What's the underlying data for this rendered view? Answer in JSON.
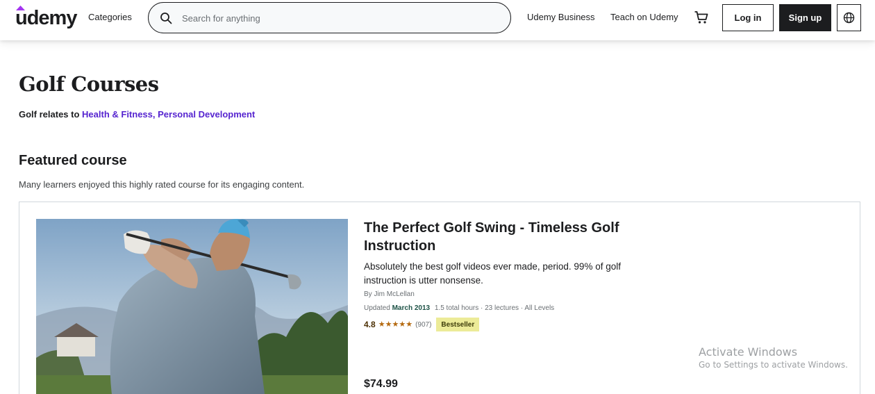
{
  "header": {
    "logo": "udemy",
    "categories_label": "Categories",
    "search_placeholder": "Search for anything",
    "business_label": "Udemy Business",
    "teach_label": "Teach on Udemy",
    "login_label": "Log in",
    "signup_label": "Sign up",
    "icons": {
      "search": "search-icon",
      "cart": "cart-icon",
      "language": "globe-icon"
    },
    "brand_color": "#a435f0"
  },
  "page": {
    "title": "Golf Courses",
    "relates_prefix": "Golf relates to ",
    "relates_links": "Health & Fitness, Personal Development",
    "link_color": "#5624d0"
  },
  "featured": {
    "heading": "Featured course",
    "subtitle": "Many learners enjoyed this highly rated course for its engaging content.",
    "course": {
      "title": "The Perfect Golf Swing - Timeless Golf Instruction",
      "description": "Absolutely the best golf videos ever made, period. 99% of golf instruction is utter nonsense.",
      "author": "By Jim McLellan",
      "updated_prefix": "Updated ",
      "updated_date": "March 2013",
      "details": "1.5 total hours · 23 lectures · All Levels",
      "rating": "4.8",
      "rating_stars": 5,
      "rating_count": "(907)",
      "badge": "Bestseller",
      "price": "$74.99"
    }
  },
  "watermark": {
    "line1": "Activate Windows",
    "line2": "Go to Settings to activate Windows."
  }
}
